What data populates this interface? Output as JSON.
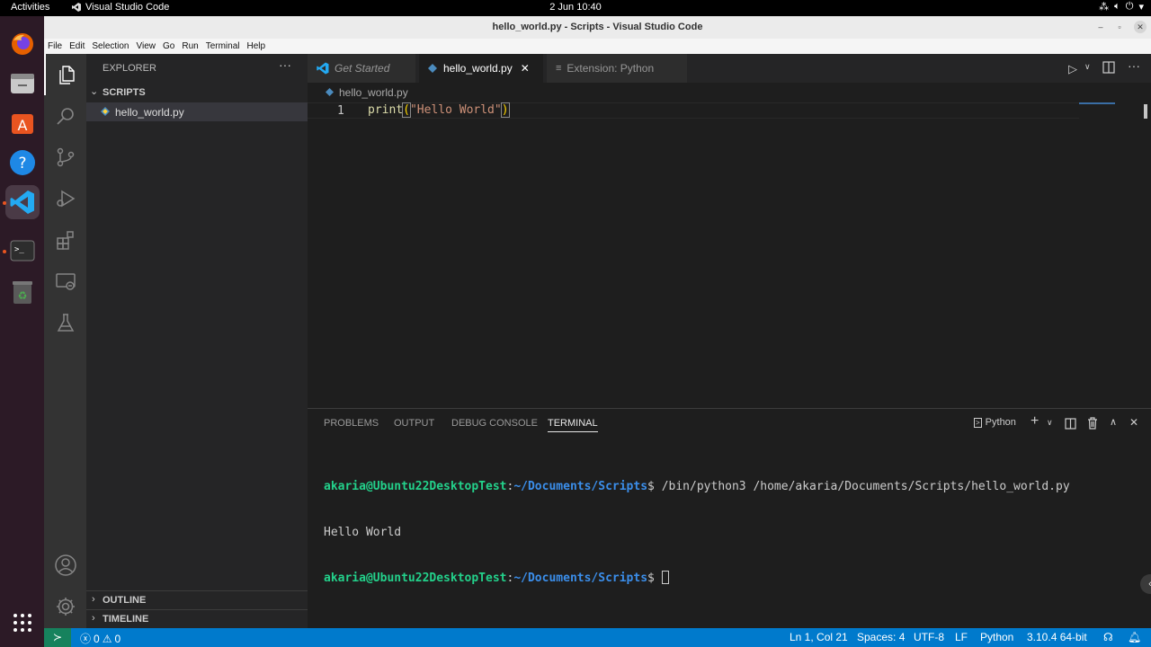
{
  "topbar": {
    "activities": "Activities",
    "app_name": "Visual Studio Code",
    "clock": "2 Jun  10:40"
  },
  "window": {
    "title": "hello_world.py - Scripts - Visual Studio Code"
  },
  "menu": [
    "File",
    "Edit",
    "Selection",
    "View",
    "Go",
    "Run",
    "Terminal",
    "Help"
  ],
  "sidebar": {
    "title": "EXPLORER",
    "folder": "SCRIPTS",
    "file": "hello_world.py",
    "outline": "OUTLINE",
    "timeline": "TIMELINE"
  },
  "tabs": [
    {
      "label": "Get Started"
    },
    {
      "label": "hello_world.py"
    },
    {
      "label": "Extension: Python"
    }
  ],
  "breadcrumb": "hello_world.py",
  "editor": {
    "line_number": "1",
    "code_fn": "print",
    "code_open": "(",
    "code_str": "\"Hello World\"",
    "code_close": ")"
  },
  "panel": {
    "tabs": [
      "PROBLEMS",
      "OUTPUT",
      "DEBUG CONSOLE",
      "TERMINAL"
    ],
    "shell": "Python",
    "prompt_user": "akaria@Ubuntu22DesktopTest",
    "prompt_sep": ":",
    "prompt_path": "~/Documents/Scripts",
    "prompt_dollar": "$",
    "command": " /bin/python3 /home/akaria/Documents/Scripts/hello_world.py",
    "output": "Hello World"
  },
  "statusbar": {
    "errors": "0",
    "warnings": "0",
    "position": "Ln 1, Col 21",
    "spaces": "Spaces: 4",
    "encoding": "UTF-8",
    "eol": "LF",
    "language": "Python",
    "interpreter": "3.10.4 64-bit"
  },
  "colors": {
    "accent": "#007acc",
    "prompt_user": "#23d18b",
    "prompt_path": "#3b8eea",
    "string": "#ce9178",
    "function": "#dcdcaa"
  }
}
